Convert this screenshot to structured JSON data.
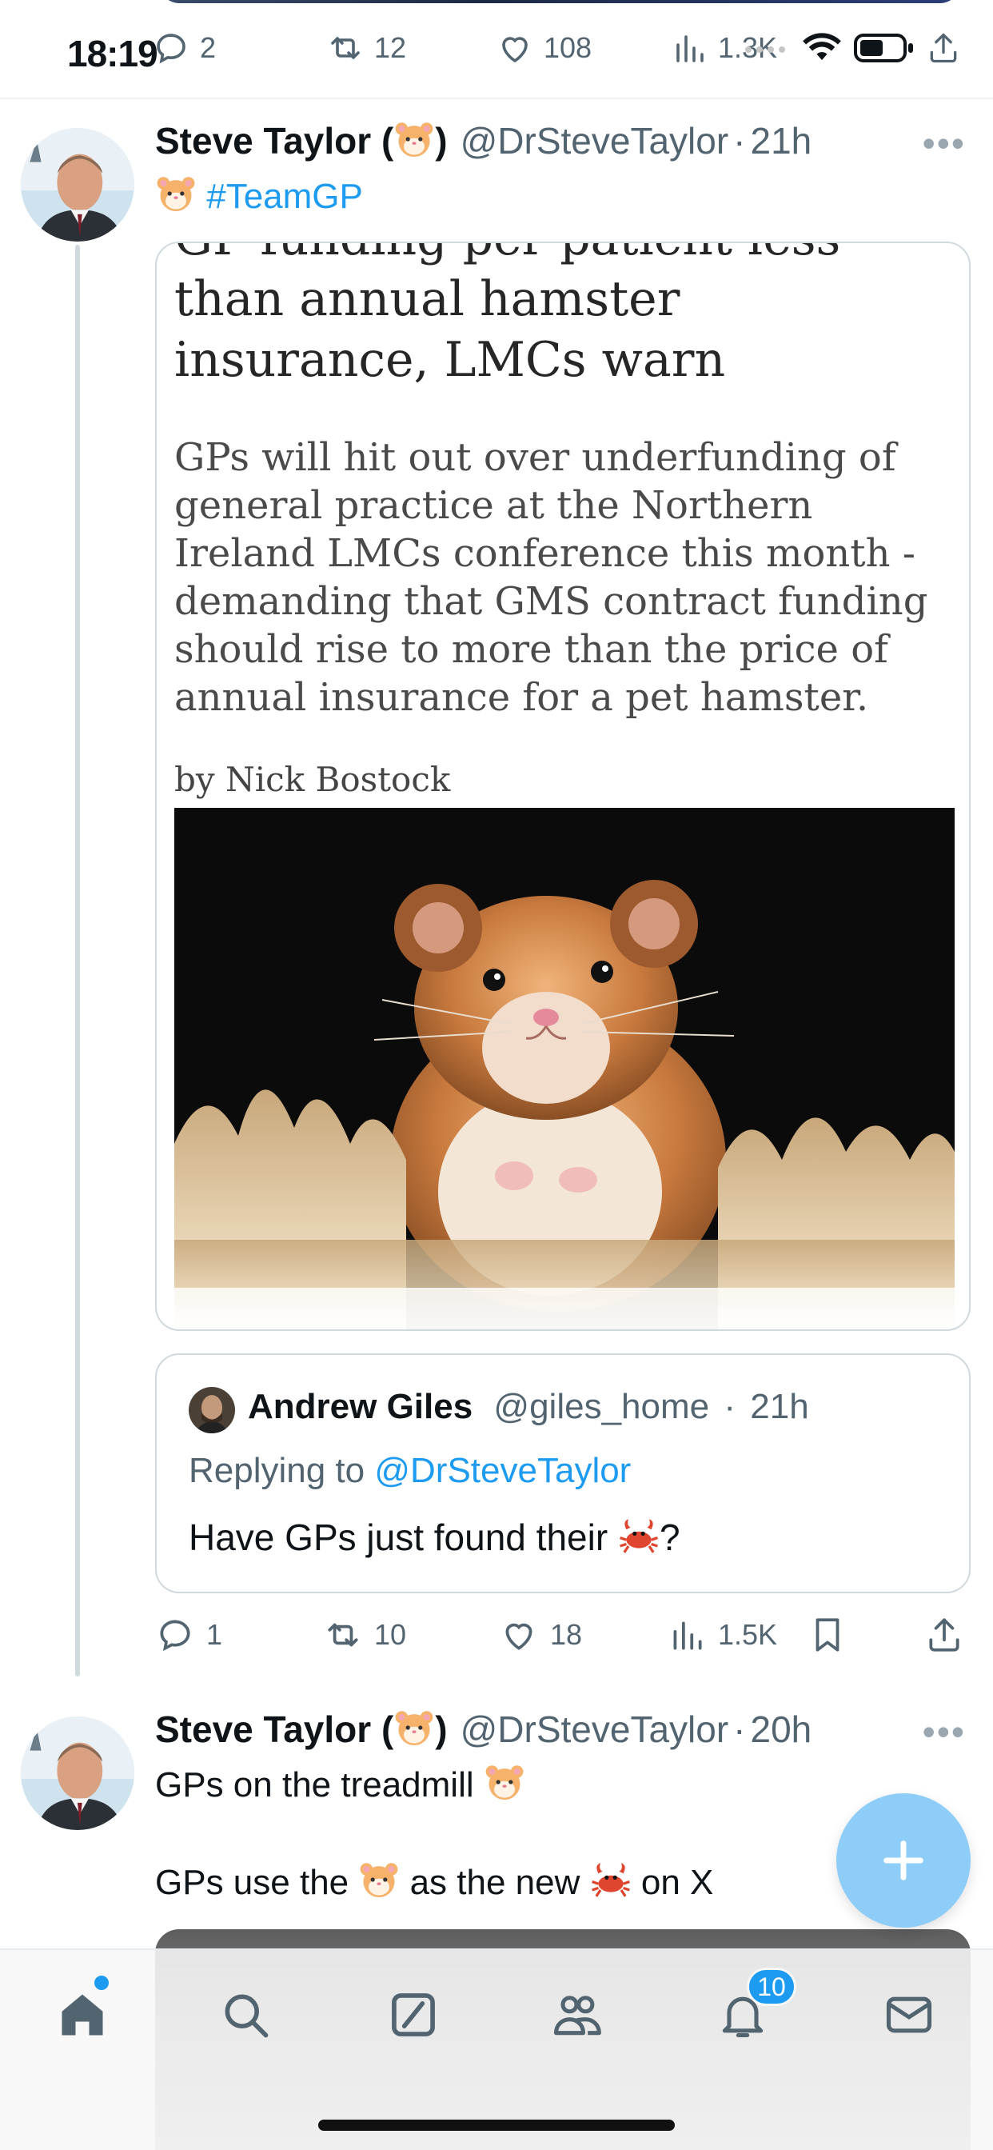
{
  "status_bar": {
    "time": "18:19"
  },
  "prev_tweet_actions": {
    "replies": "2",
    "retweets": "12",
    "likes": "108",
    "views": "1.3K"
  },
  "tweet1": {
    "display_name": "Steve Taylor (",
    "display_name_close": ")",
    "handle": "@DrSteveTaylor",
    "separator": "·",
    "time": "21h",
    "hashtag": "#TeamGP",
    "article": {
      "title_partial": "GP funding per patient less",
      "title_line2": "than annual hamster",
      "title_line3": "insurance, LMCs warn",
      "body": "GPs will hit out over underfunding of general practice at the Northern Ireland LMCs conference this month - demanding that GMS contract funding should rise to more than the price of annual insurance for a pet hamster.",
      "byline": "by Nick Bostock"
    },
    "quote": {
      "name": "Andrew Giles",
      "handle": "@giles_home",
      "separator": "·",
      "time": "21h",
      "replying_prefix": "Replying to ",
      "replying_handle": "@DrSteveTaylor",
      "text_before": "Have GPs just found their ",
      "text_after": "?"
    },
    "actions": {
      "replies": "1",
      "retweets": "10",
      "likes": "18",
      "views": "1.5K"
    }
  },
  "tweet2": {
    "display_name": "Steve Taylor (",
    "display_name_close": ")",
    "handle": "@DrSteveTaylor",
    "separator": "·",
    "time": "20h",
    "line1": "GPs on the treadmill ",
    "line2_a": "GPs use the ",
    "line2_b": " as the new ",
    "line2_c": " on X"
  },
  "bottom_nav": {
    "notifications_badge": "10",
    "items": [
      "home-icon",
      "search-icon",
      "grok-icon",
      "communities-icon",
      "notifications-icon",
      "messages-icon"
    ]
  },
  "colors": {
    "accent": "#1d9bf0",
    "fab": "#8ecdf7",
    "secondary_text": "#536471"
  }
}
